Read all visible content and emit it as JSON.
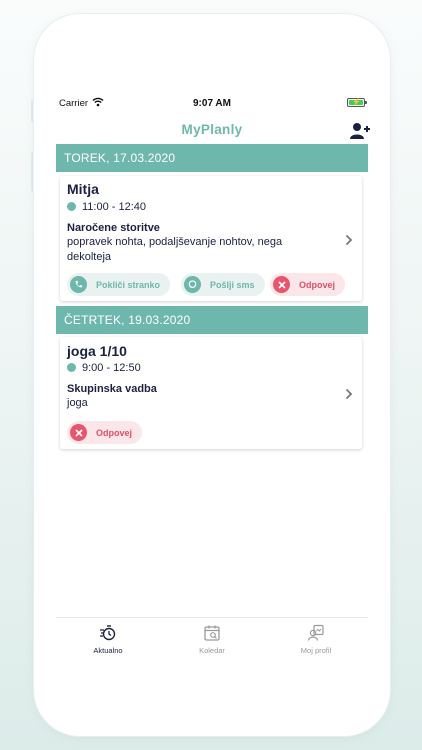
{
  "status_bar": {
    "carrier": "Carrier",
    "time": "9:07 AM"
  },
  "app": {
    "title": "MyPlanly"
  },
  "days": [
    {
      "header": "TOREK, 17.03.2020",
      "appointment": {
        "title": "Mitja",
        "time": "11:00 - 12:40",
        "service_label": "Naročene storitve",
        "service_text": "popravek nohta,  podaljševanje nohtov,  nega dekolteja",
        "actions": {
          "call": "Pokliči stranko",
          "sms": "Pošlji sms",
          "cancel": "Odpovej"
        }
      }
    },
    {
      "header": "ČETRTEK, 19.03.2020",
      "appointment": {
        "title": "joga 1/10",
        "time": "9:00 - 12:50",
        "service_label": "Skupinska vadba",
        "service_text": "joga",
        "actions": {
          "cancel": "Odpovej"
        }
      }
    }
  ],
  "tabs": [
    {
      "label": "Aktualno",
      "icon": "current-icon",
      "active": true
    },
    {
      "label": "Koledar",
      "icon": "calendar-icon",
      "active": false
    },
    {
      "label": "Moj profil",
      "icon": "profile-icon",
      "active": false
    }
  ],
  "colors": {
    "accent": "#6eb7ac",
    "danger": "#e8566d",
    "text": "#1b2140"
  }
}
